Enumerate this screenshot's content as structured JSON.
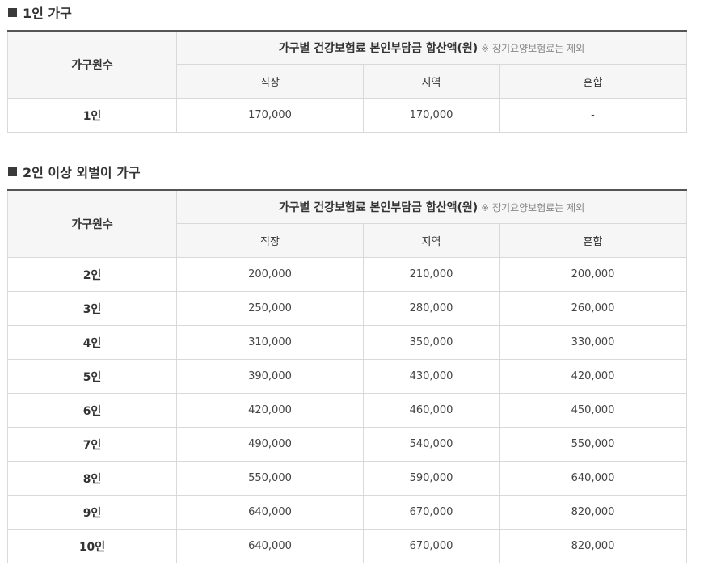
{
  "section1": {
    "title": "1인 가구",
    "header": {
      "row_head": "가구원수",
      "main": "가구별 건강보험료 본인부담금 합산액(원)",
      "note": "※ 장기요양보험료는 제외",
      "cols": [
        "직장",
        "지역",
        "혼합"
      ]
    },
    "rows": [
      {
        "label": "1인",
        "values": [
          "170,000",
          "170,000",
          "-"
        ]
      }
    ]
  },
  "section2": {
    "title": "2인 이상 외벌이 가구",
    "header": {
      "row_head": "가구원수",
      "main": "가구별 건강보험료 본인부담금 합산액(원)",
      "note": "※ 장기요양보험료는 제외",
      "cols": [
        "직장",
        "지역",
        "혼합"
      ]
    },
    "rows": [
      {
        "label": "2인",
        "values": [
          "200,000",
          "210,000",
          "200,000"
        ]
      },
      {
        "label": "3인",
        "values": [
          "250,000",
          "280,000",
          "260,000"
        ]
      },
      {
        "label": "4인",
        "values": [
          "310,000",
          "350,000",
          "330,000"
        ]
      },
      {
        "label": "5인",
        "values": [
          "390,000",
          "430,000",
          "420,000"
        ]
      },
      {
        "label": "6인",
        "values": [
          "420,000",
          "460,000",
          "450,000"
        ]
      },
      {
        "label": "7인",
        "values": [
          "490,000",
          "540,000",
          "550,000"
        ]
      },
      {
        "label": "8인",
        "values": [
          "550,000",
          "590,000",
          "640,000"
        ]
      },
      {
        "label": "9인",
        "values": [
          "640,000",
          "670,000",
          "820,000"
        ]
      },
      {
        "label": "10인",
        "values": [
          "640,000",
          "670,000",
          "820,000"
        ]
      }
    ]
  }
}
